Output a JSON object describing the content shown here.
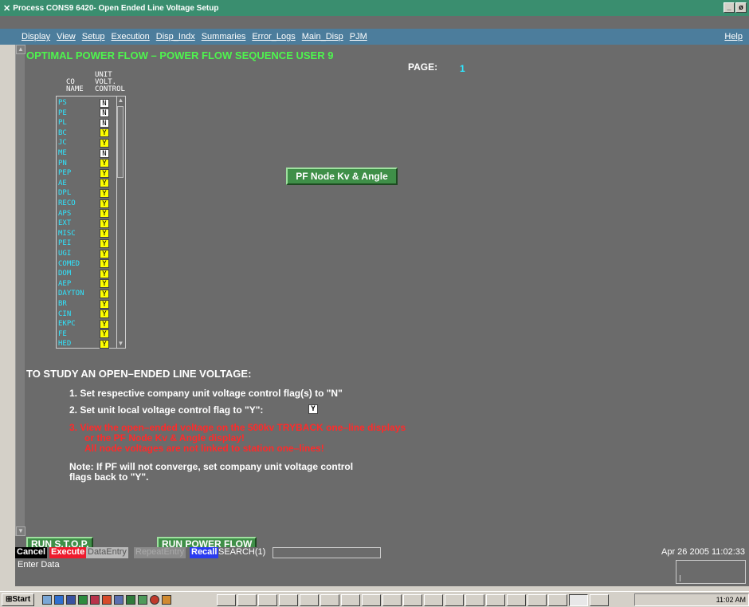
{
  "window": {
    "title": "Process CONS9 6420- Open Ended Line Voltage Setup",
    "controls": [
      "_",
      "ø"
    ]
  },
  "menu": {
    "items": [
      "Display",
      "View",
      "Setup",
      "Execution",
      "Disp_Indx",
      "Summaries",
      "Error_Logs",
      "Main_Disp",
      "PJM"
    ],
    "help": "Help"
  },
  "screen": {
    "title": "OPTIMAL POWER FLOW – POWER FLOW SEQUENCE USER  9",
    "page_label": "PAGE:",
    "page_number": "1"
  },
  "table": {
    "col_co": "CO\nNAME",
    "col_unit": "UNIT\nVOLT.\nCONTROL",
    "rows": [
      {
        "name": "PS",
        "flag": "N"
      },
      {
        "name": "PE",
        "flag": "N"
      },
      {
        "name": "PL",
        "flag": "N"
      },
      {
        "name": "BC",
        "flag": "Y"
      },
      {
        "name": "JC",
        "flag": "Y"
      },
      {
        "name": "ME",
        "flag": "N"
      },
      {
        "name": "PN",
        "flag": "Y"
      },
      {
        "name": "PEP",
        "flag": "Y"
      },
      {
        "name": "AE",
        "flag": "Y"
      },
      {
        "name": "DPL",
        "flag": "Y"
      },
      {
        "name": "RECO",
        "flag": "Y"
      },
      {
        "name": "APS",
        "flag": "Y"
      },
      {
        "name": "EXT",
        "flag": "Y"
      },
      {
        "name": "MISC",
        "flag": "Y"
      },
      {
        "name": "PEI",
        "flag": "Y"
      },
      {
        "name": "UGI",
        "flag": "Y"
      },
      {
        "name": "COMED",
        "flag": "Y"
      },
      {
        "name": "DOM",
        "flag": "Y"
      },
      {
        "name": "AEP",
        "flag": "Y"
      },
      {
        "name": "DAYTON",
        "flag": "Y"
      },
      {
        "name": "BR",
        "flag": "Y"
      },
      {
        "name": "CIN",
        "flag": "Y"
      },
      {
        "name": "EKPC",
        "flag": "Y"
      },
      {
        "name": "FE",
        "flag": "Y"
      },
      {
        "name": "HED",
        "flag": "Y"
      }
    ]
  },
  "buttons": {
    "pf_node": "PF Node Kv & Angle",
    "run_stop": "RUN S.T.O.P.",
    "run_power_flow": "RUN POWER FLOW"
  },
  "instructions": {
    "heading": "TO STUDY AN OPEN–ENDED LINE VOLTAGE:",
    "step1": "1.  Set respective company unit voltage control flag(s) to \"N\"",
    "step2": "2.  Set unit local voltage control flag to \"Y\":",
    "local_flag": "Y",
    "step3_line1": "3.  View the open–ended voltage on the 500kv TRYBACK one–line displays",
    "step3_line2": "or the PF Node Kv & Angle display!",
    "step3_line3": "All node voltages are not linked to station one–lines!",
    "note_line1": "Note:  If PF will not converge, set company unit voltage control",
    "note_line2": "flags back to \"Y\"."
  },
  "command_bar": {
    "cancel": "Cancel",
    "execute": "Execute",
    "data_entry": "DataEntry",
    "repeat_entry": "RepeatEntry",
    "recall": "Recall",
    "search": "SEARCH(1)",
    "datetime": "Apr 26 2005 11:02:33"
  },
  "message": {
    "text": "Enter Data"
  },
  "taskbar": {
    "start": "Start",
    "clock": "11:02 AM"
  },
  "colors": {
    "title_green": "#4ef54e",
    "co_cyan": "#2ee6ff",
    "flag_yellow": "#ffff00",
    "warning_red": "#ff2a2a",
    "button_green": "#3f8f48",
    "menu_blue": "#4c7d9c",
    "panel_gray": "#6b6b6b"
  }
}
